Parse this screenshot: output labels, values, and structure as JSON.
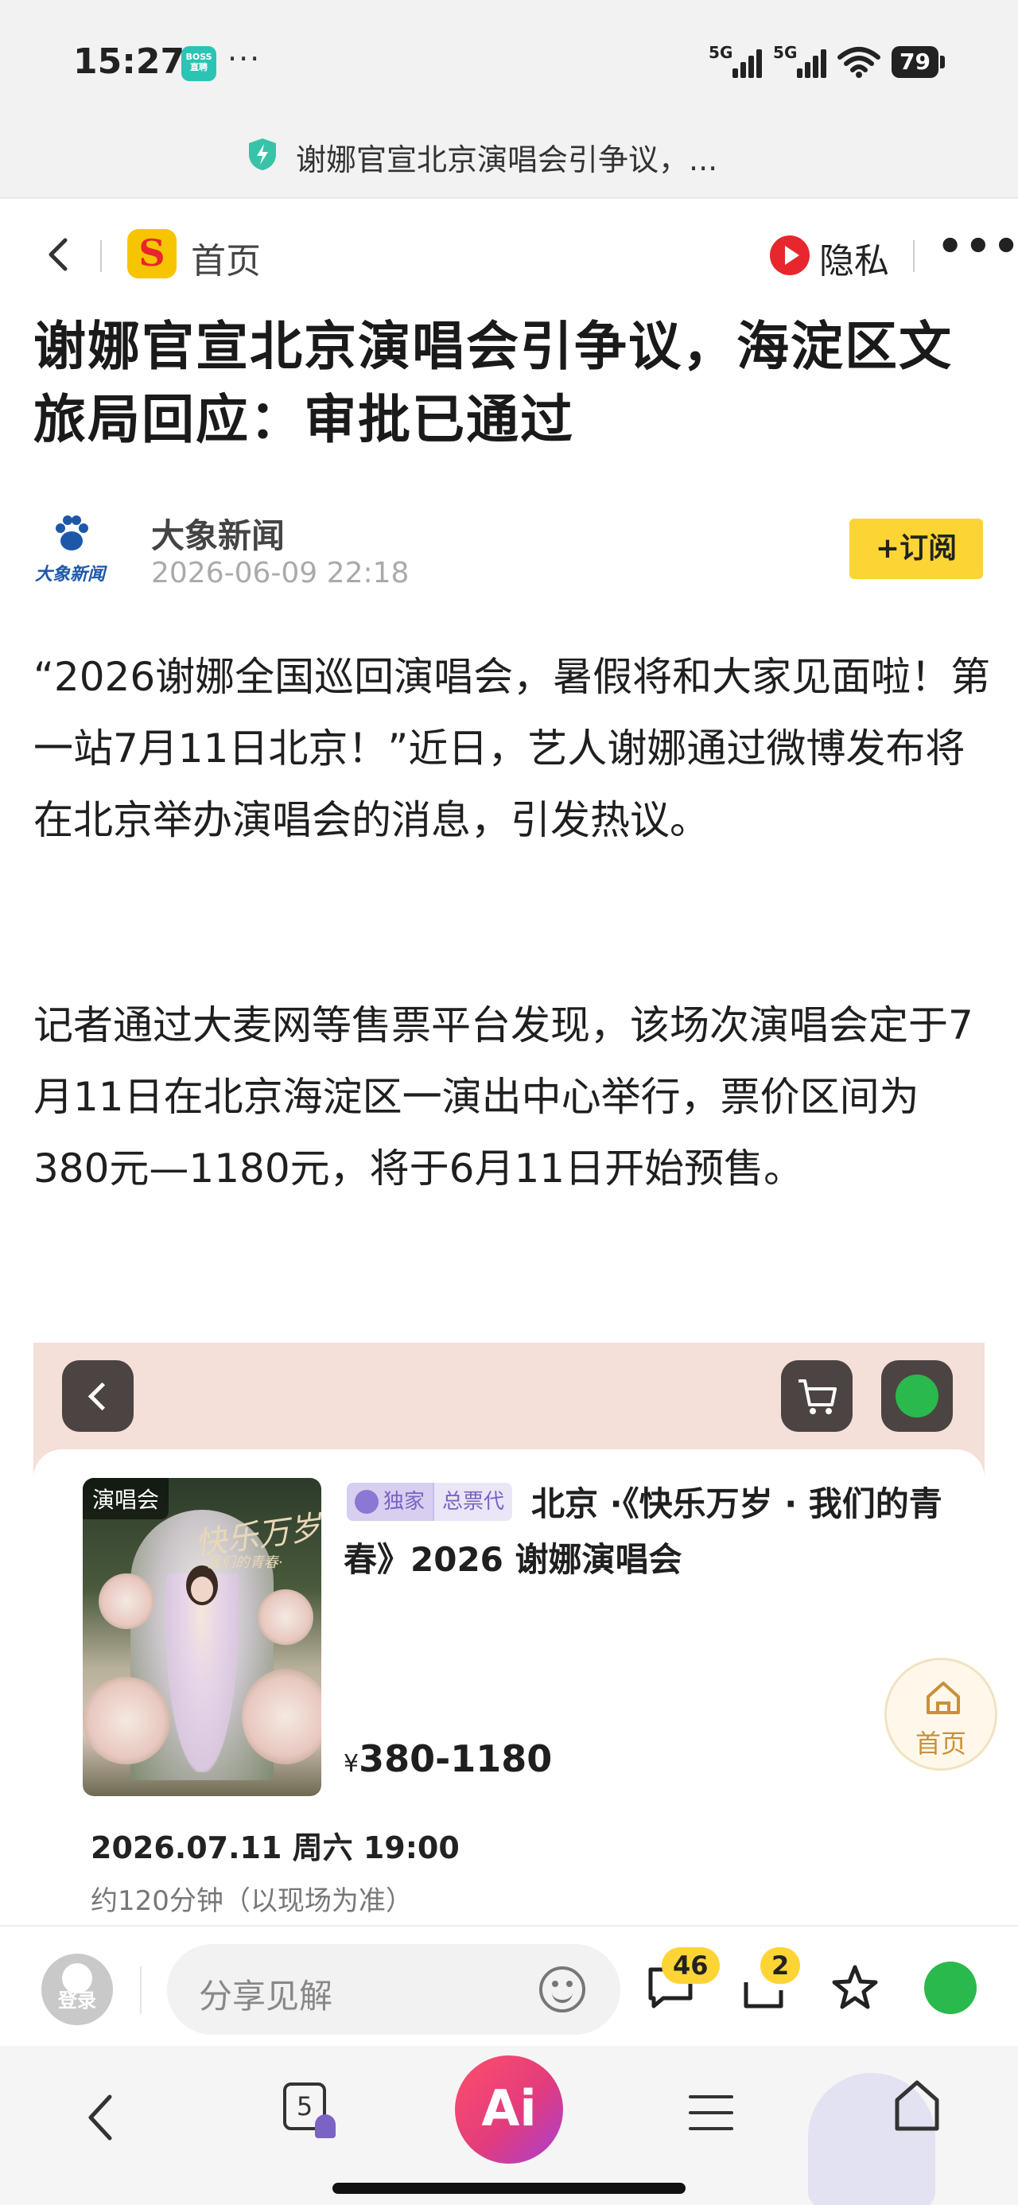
{
  "status_bar": {
    "time": "15:27",
    "app_badge": "BOSS直聘",
    "more": "···",
    "signal1_label": "5G",
    "signal2_label": "5G",
    "battery": "79"
  },
  "url_bar": {
    "text": "谢娜官宣北京演唱会引争议，..."
  },
  "nav": {
    "logo_letter": "S",
    "home_label": "首页",
    "privacy_label": "隐私",
    "more_label": "•••"
  },
  "article": {
    "title": "谢娜官宣北京演唱会引争议，海淀区文旅局回应：审批已通过",
    "author": {
      "logo_text": "大象新闻",
      "name": "大象新闻",
      "date": "2026-06-09 22:18",
      "subscribe_label": "+订阅"
    },
    "paragraphs": [
      "“2026谢娜全国巡回演唱会，暑假将和大家见面啦！第一站7月11日北京！”近日，艺人谢娜通过微博发布将在北京举办演唱会的消息，引发热议。",
      "记者通过大麦网等售票平台发现，该场次演唱会定于7月11日在北京海淀区一演出中心举行，票价区间为380元—1180元，将于6月11日开始预售。"
    ]
  },
  "embed": {
    "poster_tag": "演唱会",
    "poster_title": "快乐万岁",
    "poster_subtitle": "·我们的青春·",
    "badge_exclusive": "独家",
    "badge_agent": "总票代",
    "show_title": "北京 ·《快乐万岁 · 我们的青春》2026 谢娜演唱会",
    "price_symbol": "¥",
    "price": "380-1180",
    "date": "2026.07.11 周六 19:00",
    "duration": "约120分钟（以现场为准）"
  },
  "float_home": {
    "label": "首页"
  },
  "comment_bar": {
    "login_label": "登录",
    "input_placeholder": "分享见解",
    "comment_count": "46",
    "share_count": "2"
  },
  "browser_bar": {
    "tabs_count": "5",
    "ai_label": "Ai"
  }
}
